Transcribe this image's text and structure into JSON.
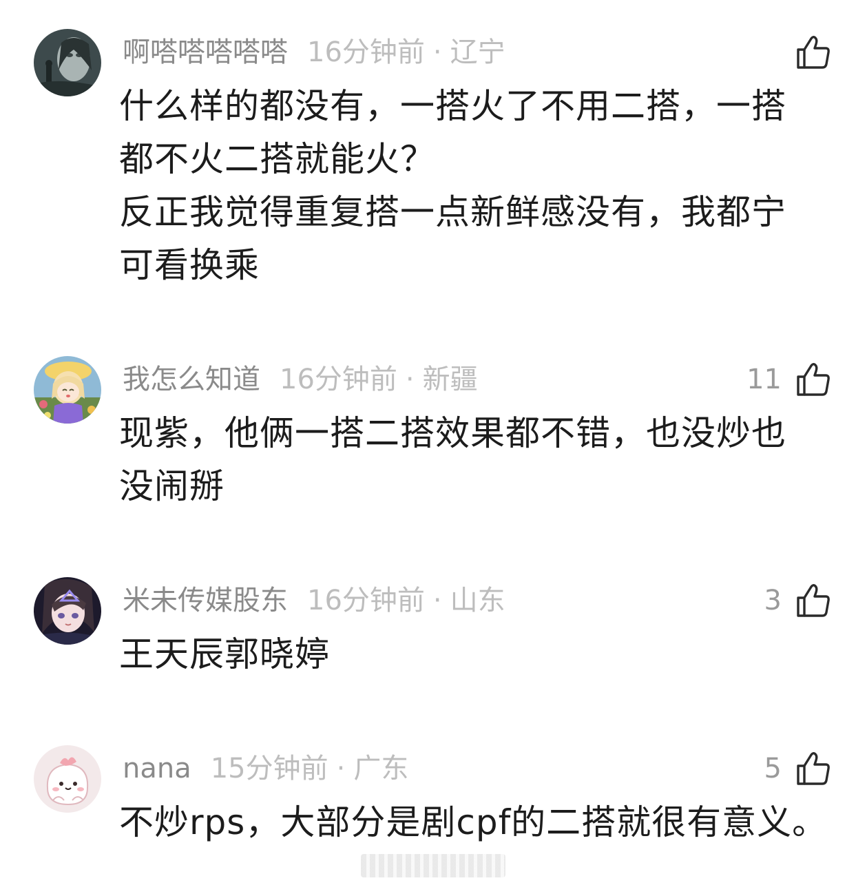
{
  "comments": [
    {
      "username": "啊嗒嗒嗒嗒嗒",
      "time": "16分钟前",
      "separator": "·",
      "location": "辽宁",
      "likes": "",
      "avatar": "dark-portrait-avatar",
      "text": "什么样的都没有，一搭火了不用二搭，一搭\n都不火二搭就能火？\n反正我觉得重复搭一点新鲜感没有，我都宁\n可看换乘"
    },
    {
      "username": "我怎么知道",
      "time": "16分钟前",
      "separator": "·",
      "location": "新疆",
      "likes": "11",
      "avatar": "anime-girl-avatar",
      "text": "现紫，他俩一搭二搭效果都不错，也没炒也\n没闹掰"
    },
    {
      "username": "米未传媒股东",
      "time": "16分钟前",
      "separator": "·",
      "location": "山东",
      "likes": "3",
      "avatar": "anime-portrait-avatar",
      "text": "王天辰郭晓婷"
    },
    {
      "username": "nana",
      "time": "15分钟前",
      "separator": "·",
      "location": "广东",
      "likes": "5",
      "avatar": "pink-blob-avatar",
      "text": "不炒rps，大部分是剧cpf的二搭就很有意义。"
    }
  ],
  "icons": {
    "like": "thumbs-up-icon"
  },
  "colors": {
    "username": "#8a8a8a",
    "meta": "#bdbdbd",
    "text": "#1c1c1c"
  }
}
